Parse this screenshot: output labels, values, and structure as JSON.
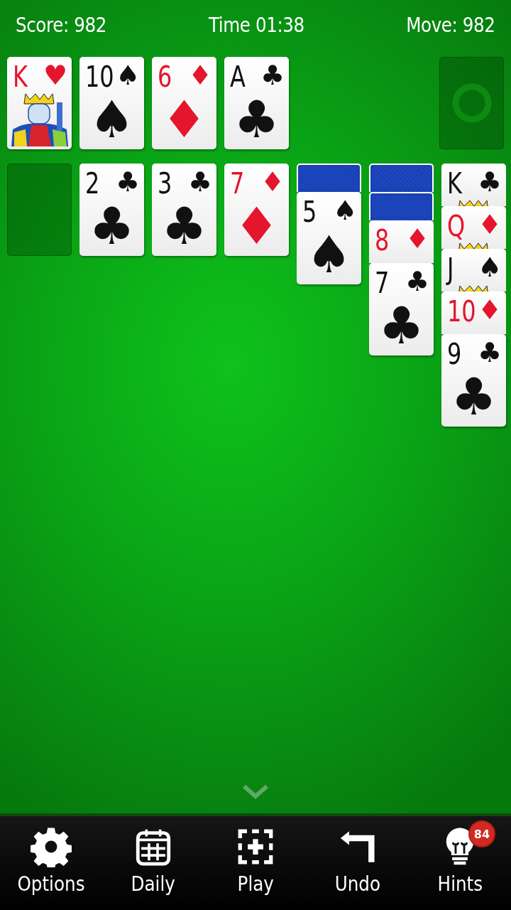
{
  "status": {
    "score": "Score: 982",
    "time": "Time 01:38",
    "moves": "Move: 982"
  },
  "foundations": [
    {
      "rank": "K",
      "suit": "♥",
      "red": true,
      "face": true
    },
    {
      "rank": "10",
      "suit": "♠",
      "red": false
    },
    {
      "rank": "6",
      "suit": "♦",
      "red": true
    },
    {
      "rank": "A",
      "suit": "♣",
      "red": false
    }
  ],
  "stock": {
    "empty": true
  },
  "tableau": [
    {
      "kind": "empty"
    },
    {
      "kind": "pile",
      "cards": [
        {
          "rank": "2",
          "suit": "♣",
          "red": false,
          "face_up": true
        }
      ]
    },
    {
      "kind": "pile",
      "cards": [
        {
          "rank": "3",
          "suit": "♣",
          "red": false,
          "face_up": true
        }
      ]
    },
    {
      "kind": "pile",
      "cards": [
        {
          "rank": "7",
          "suit": "♦",
          "red": true,
          "face_up": true
        }
      ]
    },
    {
      "kind": "pile",
      "cards": [
        {
          "face_up": false
        },
        {
          "rank": "5",
          "suit": "♠",
          "red": false,
          "face_up": true
        }
      ]
    },
    {
      "kind": "pile",
      "cards": [
        {
          "face_up": false
        },
        {
          "face_up": false
        },
        {
          "rank": "8",
          "suit": "♦",
          "red": true,
          "face_up": true
        },
        {
          "rank": "7",
          "suit": "♣",
          "red": false,
          "face_up": true
        }
      ]
    },
    {
      "kind": "pile",
      "cards": [
        {
          "rank": "K",
          "suit": "♣",
          "red": false,
          "face": true,
          "face_up": true
        },
        {
          "rank": "Q",
          "suit": "♦",
          "red": true,
          "face": true,
          "face_up": true
        },
        {
          "rank": "J",
          "suit": "♠",
          "red": false,
          "face": true,
          "face_up": true
        },
        {
          "rank": "10",
          "suit": "♦",
          "red": true,
          "face_up": true
        },
        {
          "rank": "9",
          "suit": "♣",
          "red": false,
          "face_up": true
        }
      ]
    }
  ],
  "toolbar": [
    {
      "kind": "options",
      "label": "Options"
    },
    {
      "kind": "daily",
      "label": "Daily"
    },
    {
      "kind": "play",
      "label": "Play"
    },
    {
      "kind": "undo",
      "label": "Undo"
    },
    {
      "kind": "hints",
      "label": "Hints",
      "badge": "84"
    }
  ]
}
